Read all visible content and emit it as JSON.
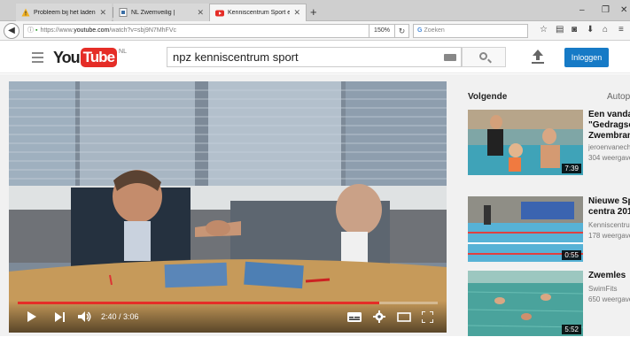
{
  "browser": {
    "tabs": [
      {
        "label": "Probleem bij het laden va...",
        "active": false
      },
      {
        "label": "NL Zwemveilig |",
        "active": false
      },
      {
        "label": "Kenniscentrum Sport en N...",
        "active": true
      }
    ],
    "new_tab": "+",
    "window_controls": {
      "minimize": "–",
      "restore": "❐",
      "close": "✕"
    },
    "url_prefix": "https://www.",
    "url_host": "youtube.com",
    "url_path": "/watch?v=sbj9N7MhFVc",
    "zoom": "150%",
    "search_placeholder": "Zoeken"
  },
  "youtube": {
    "logo_you": "You",
    "logo_tube": "Tube",
    "logo_region": "NL",
    "search_query": "npz kenniscentrum sport",
    "login_label": "Inloggen"
  },
  "player": {
    "current_time": "2:40",
    "duration": "3:06",
    "time_display": "2:40 / 3:06",
    "progress_fraction": 0.86
  },
  "sidebar": {
    "up_next_label": "Volgende",
    "autoplay_label": "Autoplay",
    "items": [
      {
        "title_lines": [
          "Een vandaag",
          "\"Gedragscode",
          "Zwembranche\""
        ],
        "channel": "jeroenvanecht",
        "views": "304 weergaven",
        "duration": "7:39"
      },
      {
        "title_lines": [
          "Nieuwe Sport",
          "centra 2017"
        ],
        "channel": "Kenniscentrum",
        "views": "178 weergaven",
        "duration": "0:55"
      },
      {
        "title_lines": [
          "Zwemles"
        ],
        "channel": "SwimFits",
        "views": "650 weergaven",
        "duration": "5:52"
      }
    ]
  },
  "colors": {
    "youtube_red": "#e52d27",
    "login_blue": "#167ac6"
  }
}
